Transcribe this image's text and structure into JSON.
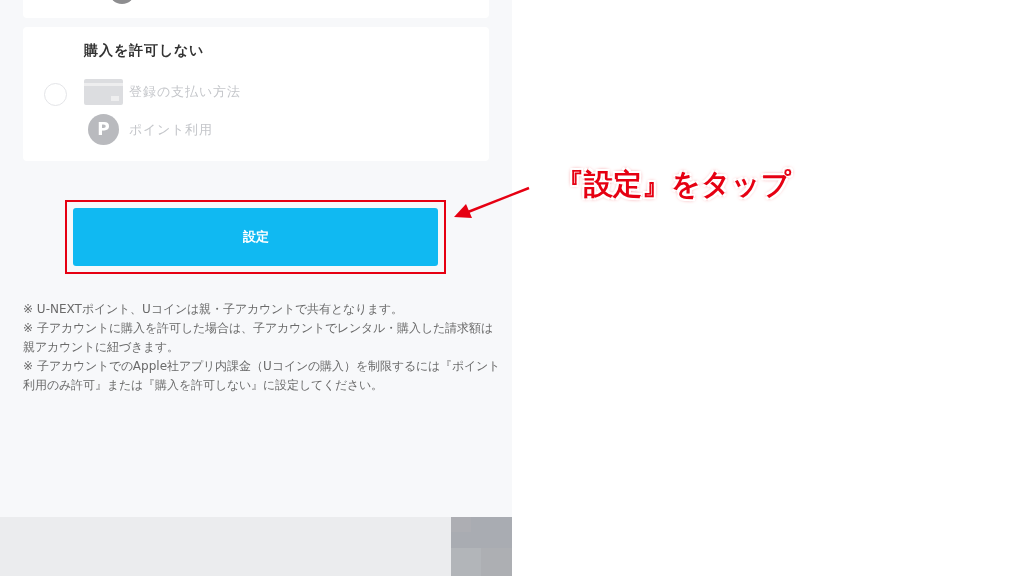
{
  "option": {
    "title": "購入を許可しない",
    "selected": false,
    "disabled": true,
    "methods": [
      {
        "kind": "card",
        "label": "登録の支払い方法"
      },
      {
        "kind": "point",
        "label": "ポイント利用",
        "badge": "P"
      }
    ]
  },
  "submit_button": {
    "label": "設定",
    "highlighted": true
  },
  "notes": [
    "※ U-NEXTポイント、Uコインは親・子アカウントで共有となります。",
    "※ 子アカウントに購入を許可した場合は、子アカウントでレンタル・購入した請求額は親アカウントに紐づきます。",
    "※ 子アカウントでのApple社アプリ内課金（Uコインの購入）を制限するには『ポイント利用のみ許可』または『購入を許可しない』に設定してください。"
  ],
  "annotation": {
    "text": "『設定』をタップ"
  }
}
